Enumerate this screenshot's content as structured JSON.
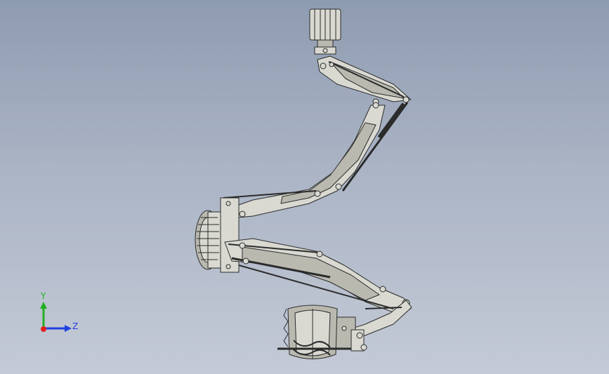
{
  "colors": {
    "part_fill": "#d9d9d2",
    "part_shade": "#b9b9b0",
    "edge": "#2b2b2b",
    "x_axis": "#e02020",
    "y_axis": "#22b022",
    "z_axis": "#2040e0"
  },
  "view_triad": {
    "y_label": "Y",
    "z_label": "Z"
  }
}
